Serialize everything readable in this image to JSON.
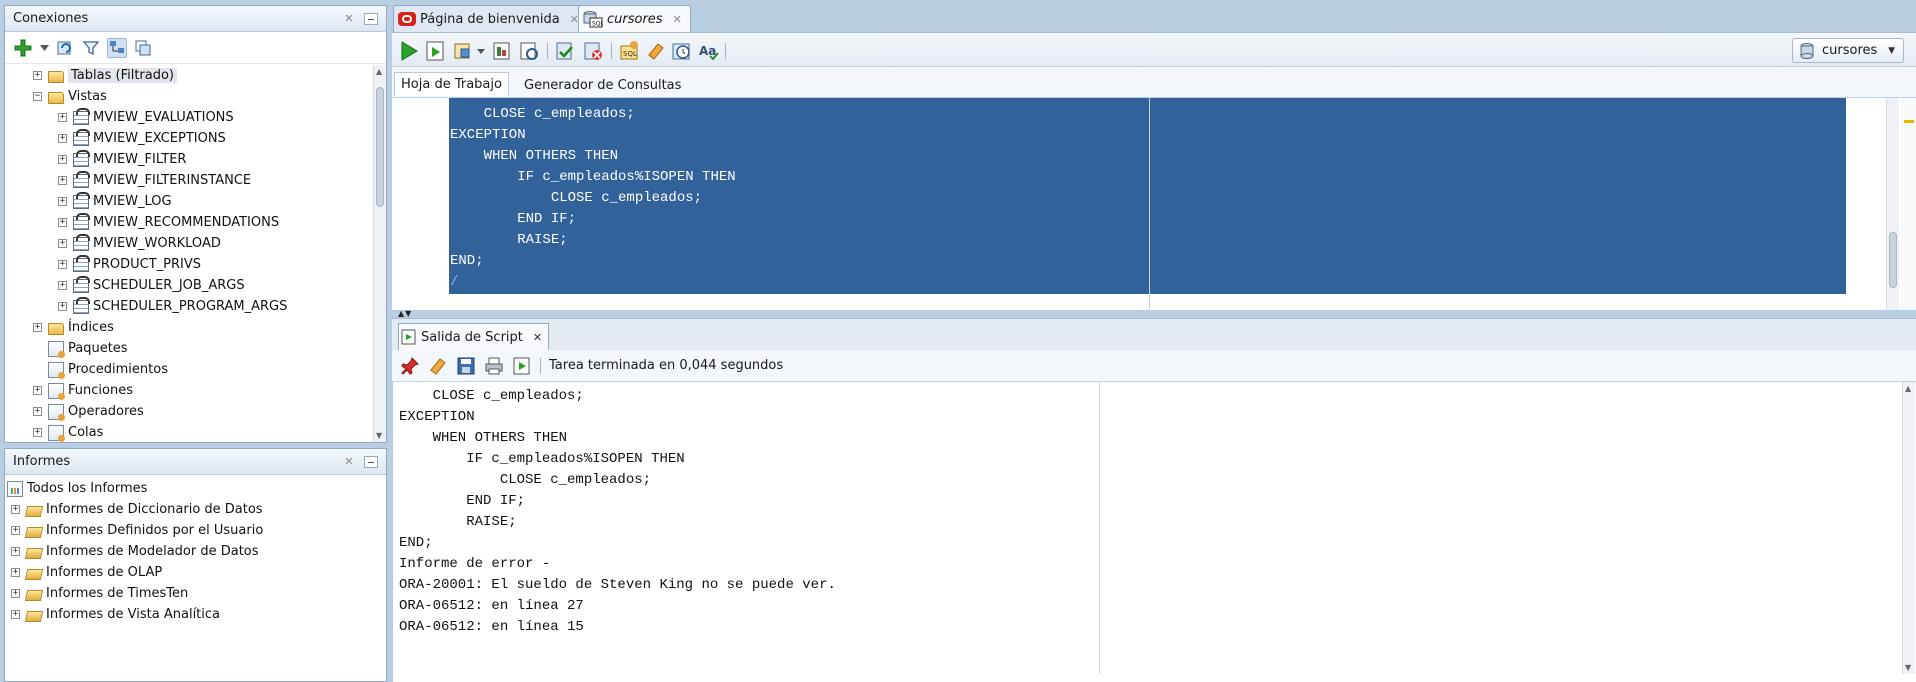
{
  "connections_panel": {
    "title": "Conexiones",
    "tree": [
      {
        "label": "Tablas (Filtrado)",
        "icon": "folder-icon",
        "level": 1
      },
      {
        "label": "Vistas",
        "icon": "folder-icon",
        "level": 1
      },
      {
        "label": "MVIEW_EVALUATIONS",
        "icon": "view-icon",
        "level": 2
      },
      {
        "label": "MVIEW_EXCEPTIONS",
        "icon": "view-icon",
        "level": 2
      },
      {
        "label": "MVIEW_FILTER",
        "icon": "view-icon",
        "level": 2
      },
      {
        "label": "MVIEW_FILTERINSTANCE",
        "icon": "view-icon",
        "level": 2
      },
      {
        "label": "MVIEW_LOG",
        "icon": "view-icon",
        "level": 2
      },
      {
        "label": "MVIEW_RECOMMENDATIONS",
        "icon": "view-icon",
        "level": 2
      },
      {
        "label": "MVIEW_WORKLOAD",
        "icon": "view-icon",
        "level": 2
      },
      {
        "label": "PRODUCT_PRIVS",
        "icon": "view-icon",
        "level": 2
      },
      {
        "label": "SCHEDULER_JOB_ARGS",
        "icon": "view-icon",
        "level": 2
      },
      {
        "label": "SCHEDULER_PROGRAM_ARGS",
        "icon": "view-icon",
        "level": 2
      },
      {
        "label": "Índices",
        "icon": "folder-icon",
        "level": 1
      },
      {
        "label": "Paquetes",
        "icon": "package-icon",
        "level": 1
      },
      {
        "label": "Procedimientos",
        "icon": "procedure-icon",
        "level": 1
      },
      {
        "label": "Funciones",
        "icon": "function-icon",
        "level": 1
      },
      {
        "label": "Operadores",
        "icon": "operator-icon",
        "level": 1
      },
      {
        "label": "Colas",
        "icon": "queue-icon",
        "level": 1
      }
    ]
  },
  "reports_panel": {
    "title": "Informes",
    "root": "Todos los Informes",
    "items": [
      "Informes de Diccionario de Datos",
      "Informes Definidos por el Usuario",
      "Informes de Modelador de Datos",
      "Informes de OLAP",
      "Informes de TimesTen",
      "Informes de Vista Analítica"
    ]
  },
  "doc_tabs": {
    "welcome": "Página de bienvenida",
    "cursores": "cursores"
  },
  "connection_selector": "cursores",
  "editor_tabs": {
    "worksheet": "Hoja de Trabajo",
    "query_builder": "Generador de Consultas"
  },
  "code_lines": [
    "    CLOSE c_empleados;",
    "EXCEPTION",
    "    WHEN OTHERS THEN",
    "        IF c_empleados%ISOPEN THEN",
    "            CLOSE c_empleados;",
    "        END IF;",
    "        RAISE;",
    "END;",
    "/"
  ],
  "script_output": {
    "tab_label": "Salida de Script",
    "status": "Tarea terminada en 0,044 segundos",
    "lines": [
      "    CLOSE c_empleados;",
      "EXCEPTION",
      "    WHEN OTHERS THEN",
      "        IF c_empleados%ISOPEN THEN",
      "            CLOSE c_empleados;",
      "        END IF;",
      "        RAISE;",
      "END;",
      "Informe de error -",
      "ORA-20001: El sueldo de Steven King no se puede ver.",
      "ORA-06512: en línea 27",
      "ORA-06512: en línea 15"
    ]
  },
  "colors": {
    "selection": "#31629a",
    "chrome": "#b9cde3"
  }
}
